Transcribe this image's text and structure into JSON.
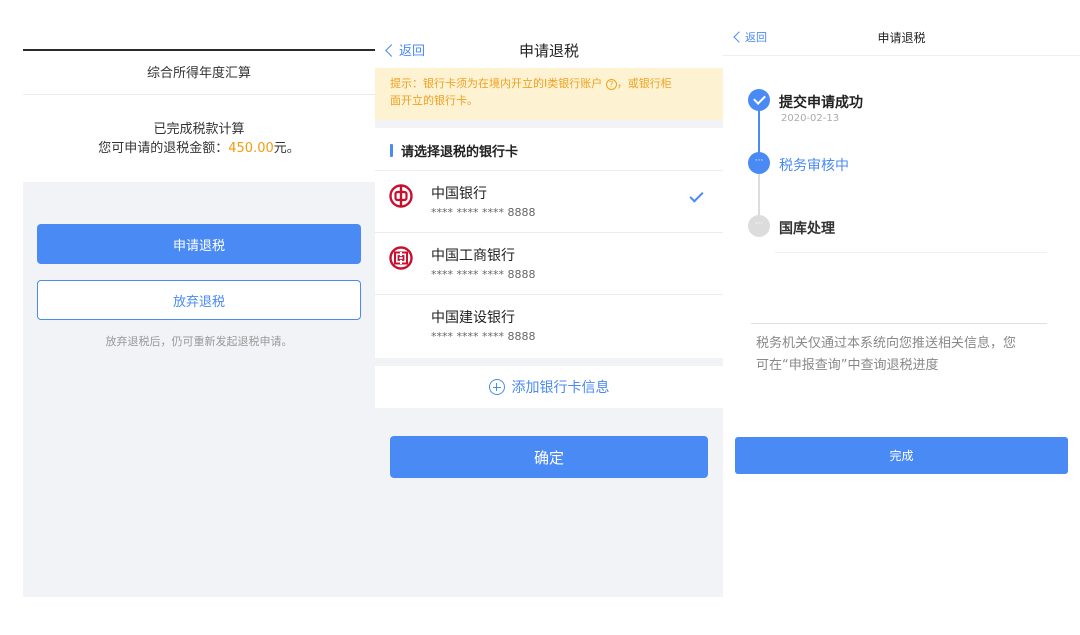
{
  "screen1": {
    "title": "综合所得年度汇算",
    "status": "已完成税款计算",
    "amount_prefix": "您可申请的退税金额：",
    "amount_value": "450.00",
    "amount_suffix": "元。",
    "apply_button": "申请退税",
    "abandon_button": "放弃退税",
    "note": "放弃退税后，仍可重新发起退税申请。"
  },
  "screen2": {
    "back_label": "返回",
    "title": "申请退税",
    "tip_line1": "提示：银行卡须为在境内开立的Ⅰ类银行账户",
    "tip_help_glyph": "?",
    "tip_line1_tail": "，或银行柜",
    "tip_line2": "面开立的银行卡。",
    "section_title": "请选择退税的银行卡",
    "banks": [
      {
        "name": "中国银行",
        "account": "**** **** **** 8888",
        "logo": "boc-logo-icon",
        "selected": true
      },
      {
        "name": "中国工商银行",
        "account": "**** **** **** 8888",
        "logo": "icbc-logo-icon",
        "selected": false
      },
      {
        "name": "中国建设银行",
        "account": "**** **** **** 8888",
        "logo": "",
        "selected": false
      }
    ],
    "add_card": "添加银行卡信息",
    "confirm_button": "确定"
  },
  "screen3": {
    "back_label": "返回",
    "title": "申请退税",
    "steps": [
      {
        "label": "提交申请成功",
        "date": "2020-02-13",
        "state": "done"
      },
      {
        "label": "税务审核中",
        "state": "active",
        "glyph": "···"
      },
      {
        "label": "国库处理",
        "state": "pending",
        "glyph": "···"
      }
    ],
    "info_line1": "税务机关仅通过本系统向您推送相关信息，您",
    "info_line2": "可在“申报查询”中查询退税进度",
    "done_button": "完成"
  },
  "colors": {
    "accent": "#4a8af4",
    "amount": "#f39c12",
    "tip_bg": "#fdf3d2",
    "tip_text": "#f0a020",
    "boc_red": "#c8102e",
    "icbc_red": "#c8102e"
  }
}
